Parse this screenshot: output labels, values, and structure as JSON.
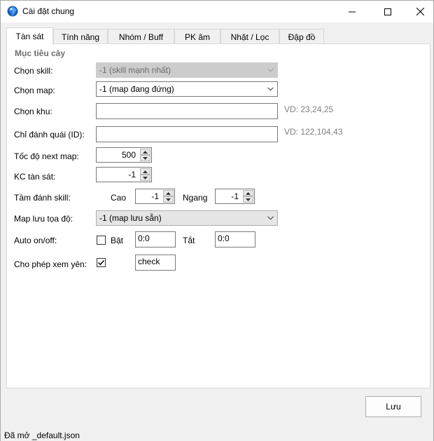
{
  "window": {
    "title": "Cài đặt chung",
    "controls": [
      "minimize-icon",
      "maximize-icon",
      "close-icon"
    ]
  },
  "tabs": [
    {
      "label": "Tàn sát",
      "active": true
    },
    {
      "label": "Tính năng",
      "active": false
    },
    {
      "label": "Nhóm / Buff",
      "active": false
    },
    {
      "label": "PK âm",
      "active": false
    },
    {
      "label": "Nhặt / Lọc",
      "active": false
    },
    {
      "label": "Đập đồ",
      "active": false
    }
  ],
  "group": {
    "title": "Mục tiêu cày"
  },
  "form": {
    "skill": {
      "label": "Chọn skill:",
      "value": "-1 (skill mạnh nhất)"
    },
    "map": {
      "label": "Chọn map:",
      "value": "-1 (map đang đứng)"
    },
    "zone": {
      "label": "Chọn khu:",
      "value": "",
      "hint": "VD: 23,24,25"
    },
    "monster": {
      "label": "Chỉ đánh quái (ID):",
      "value": "",
      "hint": "VD: 122,104,43"
    },
    "next_map_speed": {
      "label": "Tốc độ next map:",
      "value": "500"
    },
    "kill_distance": {
      "label": "KC tàn sát:",
      "value": "-1"
    },
    "skill_range": {
      "label": "Tầm đánh skill:",
      "high_label": "Cao",
      "high_value": "-1",
      "horizontal_label": "Ngang",
      "horizontal_value": "-1"
    },
    "save_coords_map": {
      "label": "Map lưu tọa độ:",
      "value": "-1 (map lưu sẵn)"
    },
    "auto": {
      "label": "Auto on/off:",
      "on_label": "Bật",
      "on_checked": false,
      "on_time": "0:0",
      "off_label": "Tắt",
      "off_time": "0:0"
    },
    "view_mount": {
      "label": "Cho phép xem yên:",
      "checked": true,
      "value": "check"
    }
  },
  "footer": {
    "save_label": "Lưu"
  },
  "status": {
    "text": "Đã mở _default.json"
  },
  "colors": {
    "border": "#7a7a7a",
    "hint": "#7f7f7f",
    "group_title": "#6d6d6d",
    "disabled": "#cccccc"
  }
}
